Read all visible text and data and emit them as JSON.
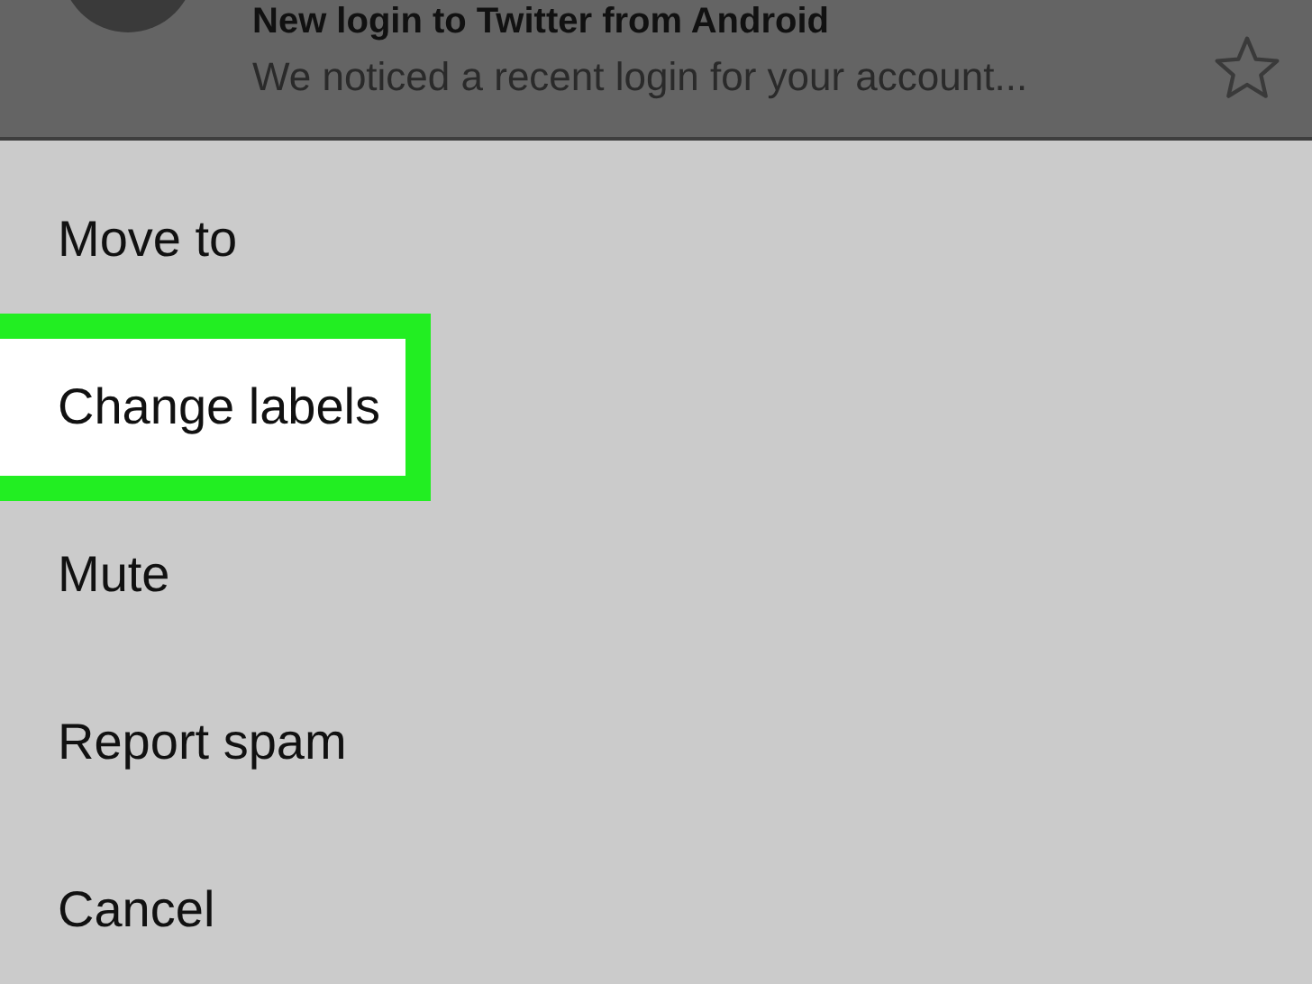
{
  "email": {
    "title": "New login to Twitter from Android",
    "preview": "We noticed a recent login for your account...",
    "starred": false
  },
  "menu": [
    {
      "label": "Move to",
      "selected": false
    },
    {
      "label": "Change labels",
      "selected": true
    },
    {
      "label": "Mute",
      "selected": false
    },
    {
      "label": "Report spam",
      "selected": false
    },
    {
      "label": "Cancel",
      "selected": false
    }
  ]
}
